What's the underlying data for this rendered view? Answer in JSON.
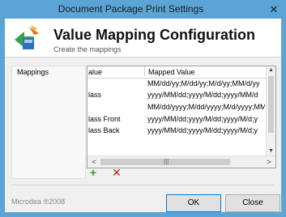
{
  "window": {
    "title": "Document Package Print Settings",
    "close_glyph": "✕"
  },
  "header": {
    "title": "Value Mapping Configuration",
    "subtitle": "Create the mappings"
  },
  "nav": {
    "items": [
      {
        "label": "Mappings"
      }
    ]
  },
  "grid": {
    "columns": [
      "alue",
      "Mapped Value"
    ],
    "rows": [
      {
        "value": "",
        "mapped": "MM/dd/yy;M/dd/yy;M/d/yy;MM/d/yy"
      },
      {
        "value": "lass",
        "mapped": "yyyy/MM/dd;yyyy/M/dd;yyyy/MM/d"
      },
      {
        "value": "",
        "mapped": "MM/dd/yyyy;M/dd/yyyy;M/d/yyyy;MM/"
      },
      {
        "value": "lass Front",
        "mapped": "yyyy/MM/dd;yyyy/M/dd;yyyy/M/d;y"
      },
      {
        "value": "lass Back",
        "mapped": "yyyy/MM/dd;yyyy/M/dd;yyyy/M/d;y"
      }
    ]
  },
  "footer": {
    "brand": "Microdea ®2008",
    "ok_label": "OK",
    "close_label": "Close"
  },
  "icons": {
    "add": "+",
    "delete": "✕"
  },
  "colors": {
    "titlebar": "#5aa5d6",
    "add_green": "#2e9c2e",
    "delete_red": "#d02020"
  }
}
